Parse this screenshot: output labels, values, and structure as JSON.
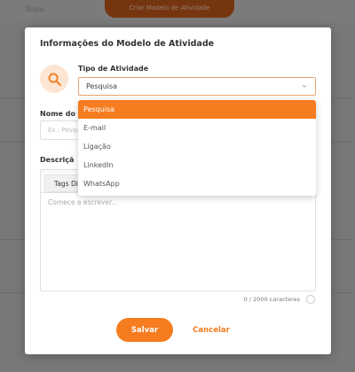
{
  "background": {
    "left_text": "Todos",
    "button_label": "Criar Modelo de Atividade"
  },
  "modal": {
    "title": "Informações do Modelo de Atividade",
    "type_label": "Tipo de Atividade",
    "type_selected": "Pesquisa",
    "type_options": [
      "Pesquisa",
      "E-mail",
      "Ligação",
      "LinkedIn",
      "WhatsApp"
    ],
    "name_label": "Nome do M",
    "name_placeholder": "Ex.: Pesqu",
    "description_label": "Descriçã",
    "tags_button": "Tags Di",
    "editor_placeholder": "Comece a escrever...",
    "char_count": "0 / 2000 caracteres",
    "save_label": "Salvar",
    "cancel_label": "Cancelar"
  },
  "colors": {
    "accent": "#f57c1f",
    "accent_light": "#fde5d3"
  },
  "icons": {
    "type_icon": "search-icon",
    "select_caret": "chevron-down-icon"
  }
}
